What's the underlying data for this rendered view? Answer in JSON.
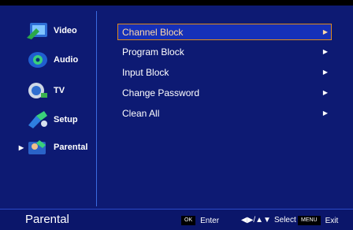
{
  "sidebar": {
    "items": [
      {
        "label": "Video",
        "icon": "video-icon"
      },
      {
        "label": "Audio",
        "icon": "audio-icon"
      },
      {
        "label": "TV",
        "icon": "tv-icon"
      },
      {
        "label": "Setup",
        "icon": "setup-icon"
      },
      {
        "label": "Parental",
        "icon": "parental-icon",
        "active": true
      }
    ],
    "active_arrow": "▶"
  },
  "menu": {
    "items": [
      {
        "label": "Channel Block",
        "chevron": "▶",
        "selected": true
      },
      {
        "label": "Program Block",
        "chevron": "▶"
      },
      {
        "label": "Input Block",
        "chevron": "▶"
      },
      {
        "label": "Change Password",
        "chevron": "▶"
      },
      {
        "label": "Clean All",
        "chevron": "▶"
      }
    ]
  },
  "status": {
    "title": "Parental",
    "ok_key": "OK",
    "ok_label": "Enter",
    "nav_glyph": "◀▶/▲▼",
    "nav_label": "Select",
    "menu_key": "MENU",
    "menu_label": "Exit"
  },
  "colors": {
    "background": "#0d1a73",
    "selected_border": "#e08a1a",
    "selected_text": "#ffd9a8",
    "divider": "#3a6be0"
  }
}
